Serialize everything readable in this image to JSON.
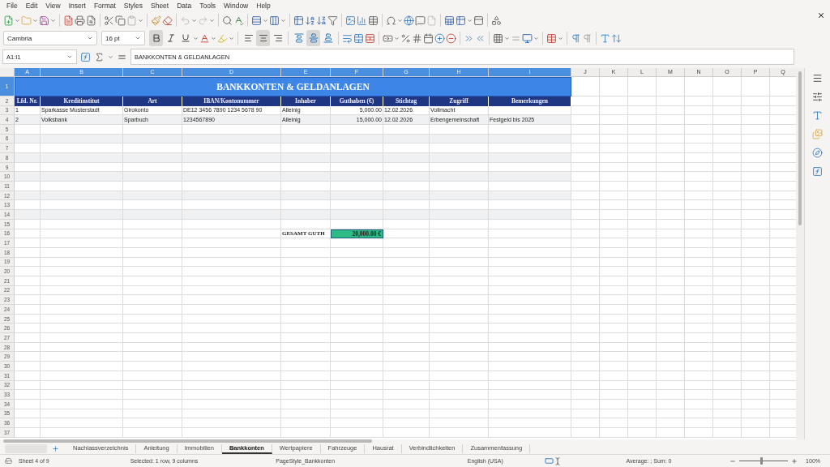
{
  "menu": [
    "File",
    "Edit",
    "View",
    "Insert",
    "Format",
    "Styles",
    "Sheet",
    "Data",
    "Tools",
    "Window",
    "Help"
  ],
  "format_bar": {
    "font_name": "Cambria",
    "font_size": "16 pt",
    "bold": true,
    "italic": false,
    "underline": false,
    "align_left": false,
    "align_center": true,
    "align_right": false,
    "align_top": false,
    "align_middle": true,
    "align_bottom": false
  },
  "formula_bar": {
    "name_box": "A1:I1",
    "content": "BANKKONTEN & GELDANLAGEN"
  },
  "columns": [
    {
      "label": "A",
      "selected": true
    },
    {
      "label": "B",
      "selected": true
    },
    {
      "label": "C",
      "selected": true
    },
    {
      "label": "D",
      "selected": true
    },
    {
      "label": "E",
      "selected": true
    },
    {
      "label": "F",
      "selected": true
    },
    {
      "label": "G",
      "selected": true
    },
    {
      "label": "H",
      "selected": true
    },
    {
      "label": "I",
      "selected": true
    },
    {
      "label": "J",
      "selected": false
    },
    {
      "label": "K",
      "selected": false
    },
    {
      "label": "L",
      "selected": false
    },
    {
      "label": "M",
      "selected": false
    },
    {
      "label": "N",
      "selected": false
    },
    {
      "label": "O",
      "selected": false
    },
    {
      "label": "P",
      "selected": false
    },
    {
      "label": "Q",
      "selected": false
    }
  ],
  "row_headers": [
    {
      "label": "1",
      "selected": true
    },
    {
      "label": "2",
      "selected": false
    },
    {
      "label": "3",
      "selected": false
    },
    {
      "label": "4",
      "selected": false
    },
    {
      "label": "5",
      "selected": false
    },
    {
      "label": "6",
      "selected": false
    },
    {
      "label": "7",
      "selected": false
    },
    {
      "label": "8",
      "selected": false
    },
    {
      "label": "9",
      "selected": false
    },
    {
      "label": "10",
      "selected": false
    },
    {
      "label": "11",
      "selected": false
    },
    {
      "label": "12",
      "selected": false
    },
    {
      "label": "13",
      "selected": false
    },
    {
      "label": "14",
      "selected": false
    },
    {
      "label": "15",
      "selected": false
    },
    {
      "label": "16",
      "selected": false
    },
    {
      "label": "17",
      "selected": false
    },
    {
      "label": "18",
      "selected": false
    },
    {
      "label": "19",
      "selected": false
    },
    {
      "label": "20",
      "selected": false
    },
    {
      "label": "21",
      "selected": false
    },
    {
      "label": "22",
      "selected": false
    },
    {
      "label": "23",
      "selected": false
    },
    {
      "label": "24",
      "selected": false
    },
    {
      "label": "25",
      "selected": false
    },
    {
      "label": "26",
      "selected": false
    },
    {
      "label": "27",
      "selected": false
    },
    {
      "label": "28",
      "selected": false
    },
    {
      "label": "29",
      "selected": false
    },
    {
      "label": "30",
      "selected": false
    },
    {
      "label": "31",
      "selected": false
    },
    {
      "label": "32",
      "selected": false
    },
    {
      "label": "33",
      "selected": false
    },
    {
      "label": "34",
      "selected": false
    },
    {
      "label": "35",
      "selected": false
    },
    {
      "label": "36",
      "selected": false
    },
    {
      "label": "37",
      "selected": false
    }
  ],
  "sheet": {
    "title": "BANKKONTEN & GELDANLAGEN",
    "headers": [
      "Lfd. Nr.",
      "Kreditinstitut",
      "Art",
      "IBAN/Kontonummer",
      "Inhaber",
      "Guthaben (€)",
      "Stichtag",
      "Zugriff",
      "Bemerkungen"
    ],
    "rows": [
      [
        "1",
        "Sparkasse Musterstadt",
        "Girokonto",
        "DE12 3456 7890 1234 5678 90",
        "Alleinig",
        "5,000.00",
        "12.02.2026",
        "Vollmacht"
      ],
      [
        "2",
        "Volksbank",
        "Sparbuch",
        "1234567890",
        "Alleinig",
        "15,000.00",
        "12.02.2026",
        "Erbengemeinschaft",
        "Festgeld bis 2025"
      ]
    ],
    "total": {
      "label": "GESAMT GUTH",
      "value": "20,000.00 €"
    }
  },
  "sheet_tabs": [
    {
      "label": "Nachlassverzeichnis",
      "selected": false
    },
    {
      "label": "Anleitung",
      "selected": false
    },
    {
      "label": "Immobilien",
      "selected": false
    },
    {
      "label": "Bankkonten",
      "selected": true
    },
    {
      "label": "Wertpapiere",
      "selected": false
    },
    {
      "label": "Fahrzeuge",
      "selected": false
    },
    {
      "label": "Hausrat",
      "selected": false
    },
    {
      "label": "Verbindlichkeiten",
      "selected": false
    },
    {
      "label": "Zusammenfassung",
      "selected": false
    }
  ],
  "status_bar": {
    "sheet": "Sheet 4 of 9",
    "selection": "Selected: 1 row, 9 columns",
    "page_style": "PageStyle_Bankkonten",
    "language": "English (USA)",
    "summary": "Average: ; Sum: 0",
    "zoom_slider": {
      "level": 0.45
    },
    "zoom": "100%"
  }
}
